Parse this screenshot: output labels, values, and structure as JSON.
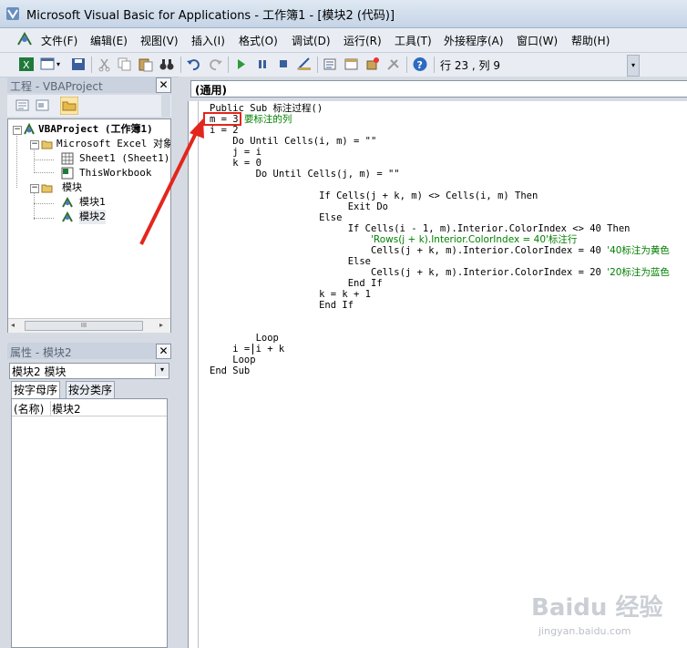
{
  "window": {
    "title": "Microsoft Visual Basic for Applications - 工作簿1 - [模块2 (代码)]"
  },
  "menu": [
    {
      "label": "文件(F)"
    },
    {
      "label": "编辑(E)"
    },
    {
      "label": "视图(V)"
    },
    {
      "label": "插入(I)"
    },
    {
      "label": "格式(O)"
    },
    {
      "label": "调试(D)"
    },
    {
      "label": "运行(R)"
    },
    {
      "label": "工具(T)"
    },
    {
      "label": "外接程序(A)"
    },
    {
      "label": "窗口(W)"
    },
    {
      "label": "帮助(H)"
    }
  ],
  "toolbar": {
    "position": "行 23 , 列 9",
    "overflow": "▾"
  },
  "project_panel": {
    "title": "工程 - VBAProject",
    "close": "✕",
    "tree": {
      "root": "VBAProject (工作簿1)",
      "excel_objects": "Microsoft Excel 对象",
      "sheet1": "Sheet1 (Sheet1)",
      "thisworkbook": "ThisWorkbook",
      "modules": "模块",
      "module1": "模块1",
      "module2": "模块2"
    },
    "scroll_grip": "III"
  },
  "properties_panel": {
    "title": "属性 - 模块2",
    "close": "✕",
    "object_select": "模块2 模块",
    "tabs": [
      "按字母序",
      "按分类序"
    ],
    "row": {
      "name": "(名称)",
      "value": "模块2"
    }
  },
  "code": {
    "combo": "(通用)",
    "lines": [
      {
        "text": "Public Sub 标注过程()",
        "comment": ""
      },
      {
        "text": "m = 3 ",
        "comment": "要标注的列"
      },
      {
        "text": "i = 2",
        "comment": ""
      },
      {
        "text": "    Do Until Cells(i, m) = \"\"",
        "comment": ""
      },
      {
        "text": "    j = i",
        "comment": ""
      },
      {
        "text": "    k = 0",
        "comment": ""
      },
      {
        "text": "        Do Until Cells(j, m) = \"\"",
        "comment": ""
      },
      {
        "text": "",
        "comment": ""
      },
      {
        "text": "                   If Cells(j + k, m) <> Cells(i, m) Then",
        "comment": ""
      },
      {
        "text": "                        Exit Do",
        "comment": ""
      },
      {
        "text": "                   Else",
        "comment": ""
      },
      {
        "text": "                        If Cells(i - 1, m).Interior.ColorIndex <> 40 Then",
        "comment": ""
      },
      {
        "text": "                            ",
        "comment": "'Rows(j + k).Interior.ColorIndex = 40'标注行"
      },
      {
        "text": "                            Cells(j + k, m).Interior.ColorIndex = 40 ",
        "comment": "'40标注为黄色"
      },
      {
        "text": "                        Else",
        "comment": ""
      },
      {
        "text": "                            Cells(j + k, m).Interior.ColorIndex = 20 ",
        "comment": "'20标注为蓝色"
      },
      {
        "text": "                        End If",
        "comment": ""
      },
      {
        "text": "                   k = k + 1",
        "comment": ""
      },
      {
        "text": "                   End If",
        "comment": ""
      },
      {
        "text": "",
        "comment": ""
      },
      {
        "text": "",
        "comment": ""
      },
      {
        "text": "        Loop",
        "comment": ""
      },
      {
        "text": "    i = i + k",
        "comment": ""
      },
      {
        "text": "    Loop",
        "comment": ""
      },
      {
        "text": "End Sub",
        "comment": ""
      }
    ]
  },
  "watermark": {
    "logo": "Baidu 经验",
    "url": "jingyan.baidu.com"
  },
  "colors": {
    "annotation": "#e3261c",
    "comment": "#008000"
  }
}
